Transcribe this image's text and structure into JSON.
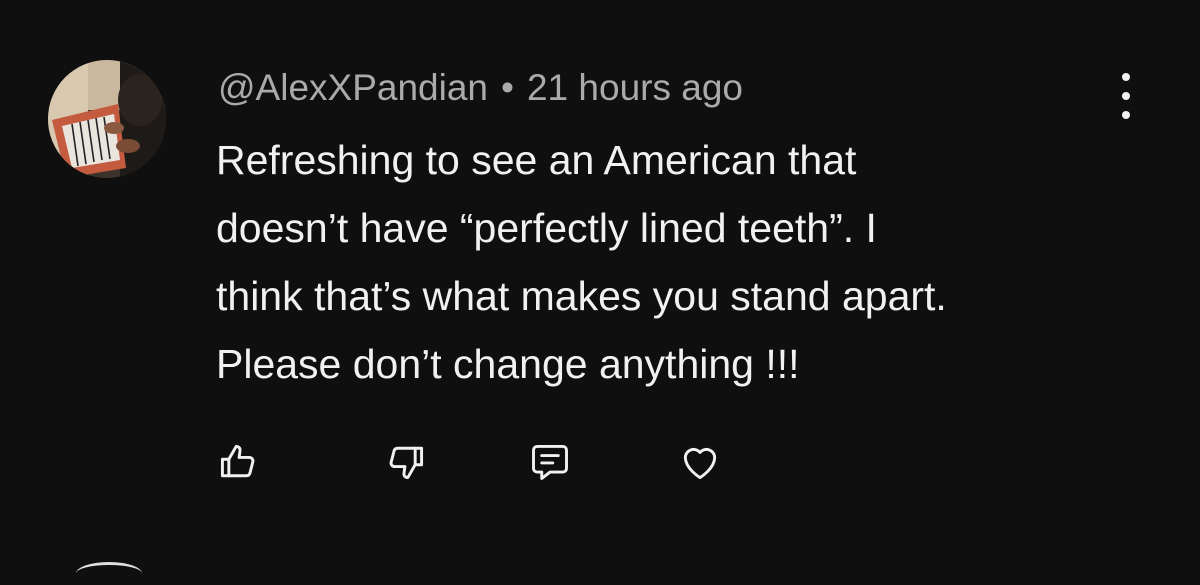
{
  "comment": {
    "author": "@AlexXPandian",
    "separator": "•",
    "timestamp": "21 hours ago",
    "text_lines": [
      "Refreshing to see an American that",
      "doesn’t have “perfectly lined teeth”. I",
      "think that’s what makes you stand apart.",
      "Please don’t change anything !!!"
    ]
  },
  "icons": {
    "more": "more-vertical-icon",
    "like": "thumbs-up-icon",
    "dislike": "thumbs-down-icon",
    "reply": "reply-icon",
    "heart": "heart-icon"
  },
  "colors": {
    "background": "#0f0f0f",
    "text_primary": "#f1f1f1",
    "text_secondary": "#aaaaaa"
  }
}
